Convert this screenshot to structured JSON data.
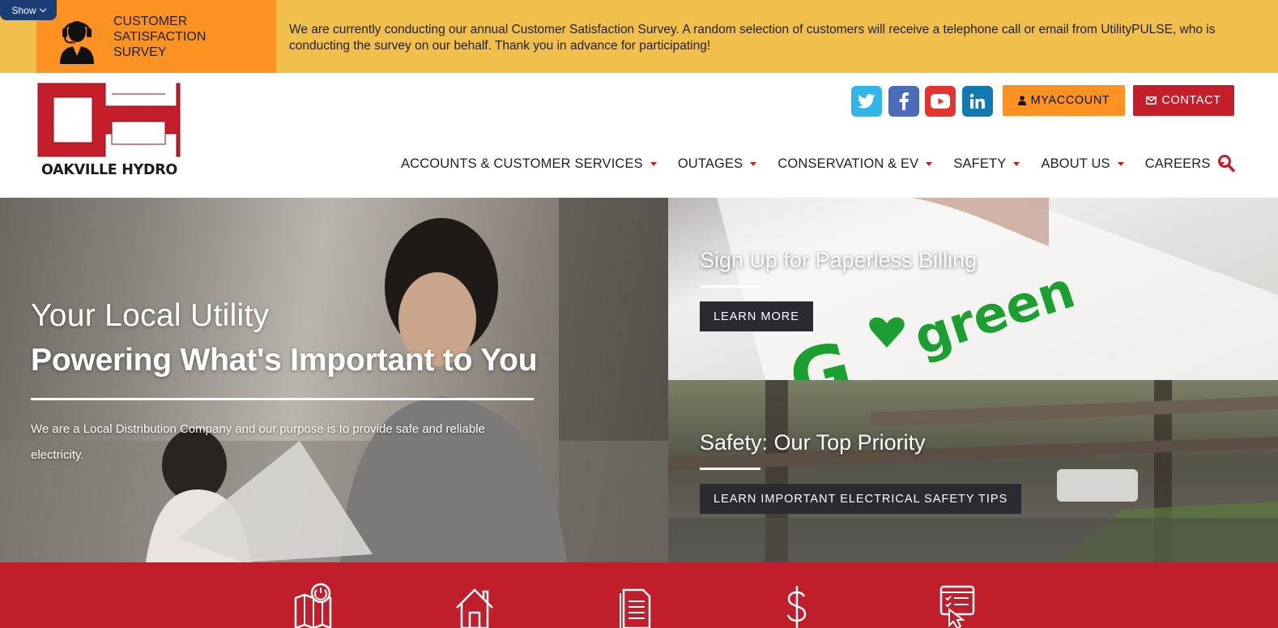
{
  "survey": {
    "show_label": "Show",
    "title": "CUSTOMER SATISFACTION SURVEY",
    "message": "We are currently conducting our annual Customer Satisfaction Survey. A random selection of customers will receive a telephone call or email from UtilityPULSE, who is conducting the survey on our behalf. Thank you in advance for participating!"
  },
  "header": {
    "logo_text": "OAKVILLE HYDRO",
    "social": [
      {
        "name": "twitter-icon",
        "color": "#30b6e9"
      },
      {
        "name": "facebook-icon",
        "color": "#4a6cba"
      },
      {
        "name": "youtube-icon",
        "color": "#e33530"
      },
      {
        "name": "linkedin-icon",
        "color": "#1178b1"
      }
    ],
    "myaccount_label": "MYACCOUNT",
    "contact_label": "CONTACT"
  },
  "nav": {
    "items": [
      {
        "label": "ACCOUNTS & CUSTOMER SERVICES"
      },
      {
        "label": "OUTAGES"
      },
      {
        "label": "CONSERVATION & EV"
      },
      {
        "label": "SAFETY"
      },
      {
        "label": "ABOUT US"
      },
      {
        "label": "CAREERS"
      }
    ],
    "search_icon": "search-icon"
  },
  "hero": {
    "kicker": "Your Local Utility",
    "title": "Powering What's Important to You",
    "description": "We are a Local Distribution Company and our purpose is to provide safe and reliable electricity."
  },
  "promos": [
    {
      "title": "Sign Up for Paperless Billing",
      "button": "LEARN MORE"
    },
    {
      "title": "Safety: Our Top Priority",
      "button": "LEARN IMPORTANT ELECTRICAL SAFETY TIPS"
    }
  ],
  "quick_links": {
    "icons": [
      "outage-map-icon",
      "home-icon",
      "document-icon",
      "dollar-icon",
      "online-form-icon"
    ]
  },
  "colors": {
    "brand_red": "#c41e2a",
    "brand_orange": "#fb9221",
    "banner_yellow": "#f1bf4c"
  }
}
